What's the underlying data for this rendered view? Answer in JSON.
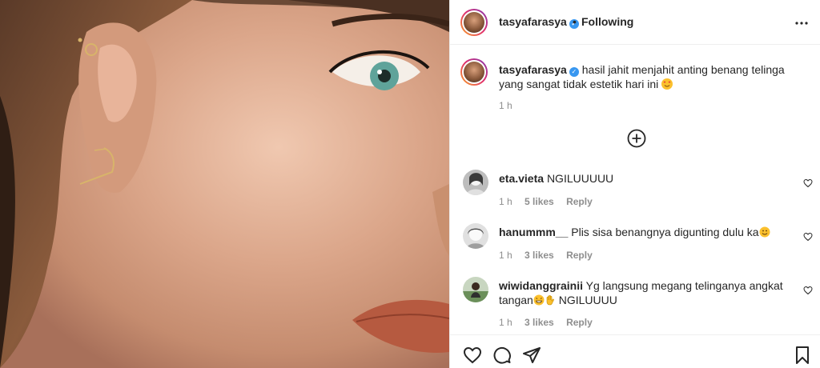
{
  "post": {
    "username": "tasyafarasya",
    "separator": "•",
    "follow_status": "Following",
    "more_icon": "more-options-icon"
  },
  "caption": {
    "username": "tasyafarasya",
    "text": "hasil jahit menjahit anting benang telinga yang sangat tidak estetik hari ini",
    "emoji": "smiling-face-with-hearts",
    "time": "1 h"
  },
  "load_more": {
    "icon": "plus-circle-icon"
  },
  "comments": [
    {
      "username": "eta.vieta",
      "text": "NGILUUUUU",
      "time": "1 h",
      "likes": "5 likes",
      "reply": "Reply"
    },
    {
      "username": "hanummm__",
      "text": "Plis sisa benangnya digunting dulu ka",
      "emoji_after": "smiling-face",
      "time": "1 h",
      "likes": "3 likes",
      "reply": "Reply"
    },
    {
      "username": "wiwidanggrainii",
      "text_before": "Yg langsung megang telinganya angkat tangan",
      "text_after": " NGILUUUU",
      "time": "1 h",
      "likes": "3 likes",
      "reply": "Reply"
    }
  ],
  "actions": {
    "like_icon": "heart-icon",
    "comment_icon": "comment-icon",
    "share_icon": "send-icon",
    "save_icon": "bookmark-icon"
  },
  "colors": {
    "verified": "#3897f0",
    "muted": "#8e8e8e",
    "border": "#efefef",
    "text": "#262626"
  }
}
